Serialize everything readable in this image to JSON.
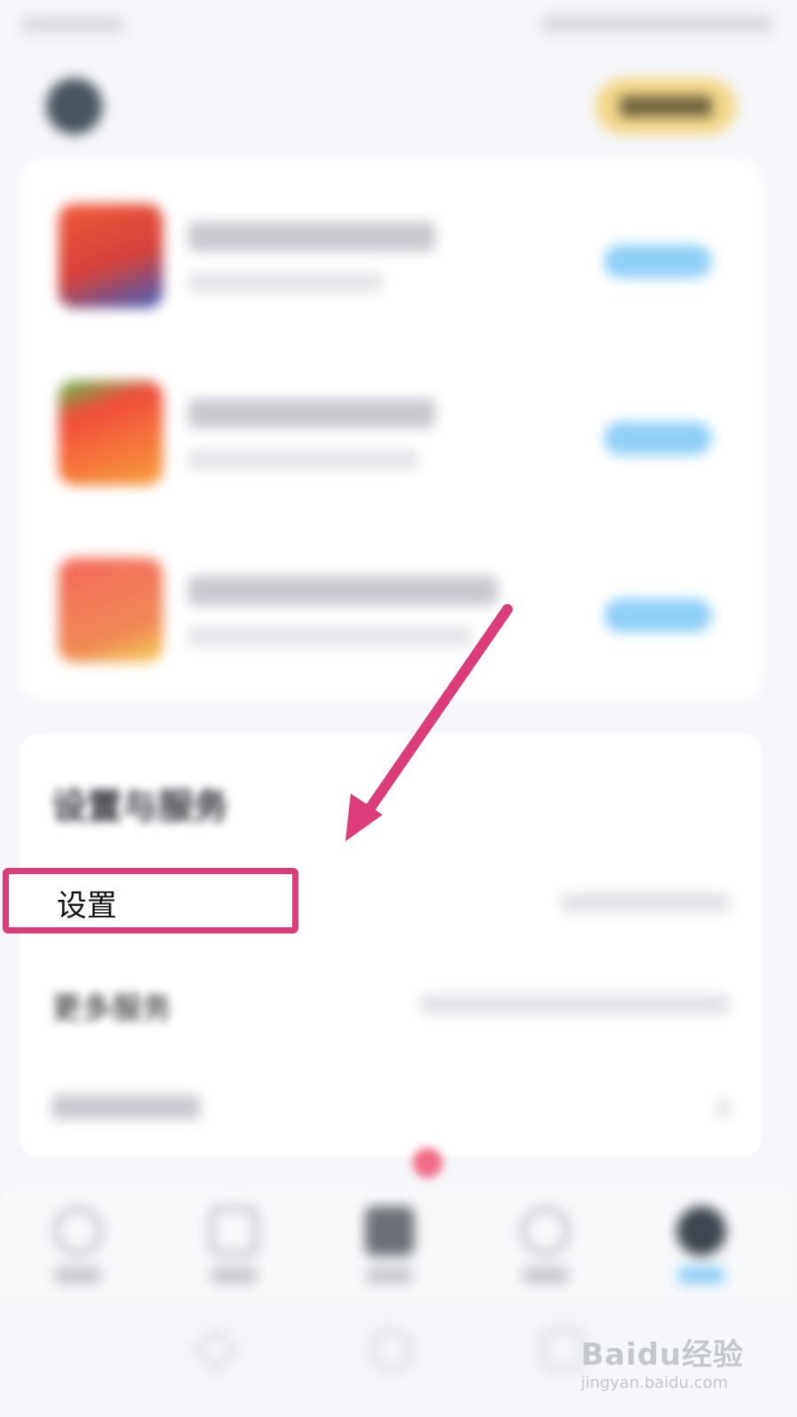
{
  "colors": {
    "accent": "#dc3c79",
    "vip_gold": "#f2d88a",
    "promo_button": "#8fd0f7",
    "badge_red": "#f06c86"
  },
  "header": {
    "user_name": "",
    "vip_label": ""
  },
  "promos": [
    {
      "title": "",
      "subtitle": "",
      "button": "",
      "thumb_color": "#e8553f"
    },
    {
      "title": "",
      "subtitle": "",
      "button": "",
      "thumb_color": "#f24b3a"
    },
    {
      "title": "",
      "subtitle": "",
      "button": "",
      "thumb_color": "#f07058"
    }
  ],
  "settings_section": {
    "title": "设置与服务",
    "items": [
      {
        "label": "设置"
      },
      {
        "label": "更多服务"
      },
      {
        "label": ""
      }
    ]
  },
  "bottom_nav": {
    "items": [
      {
        "icon": "home-icon"
      },
      {
        "icon": "discover-icon"
      },
      {
        "icon": "message-icon"
      },
      {
        "icon": "cart-icon"
      },
      {
        "icon": "profile-icon"
      }
    ]
  },
  "watermark": {
    "main": "Baidu经验",
    "sub": "jingyan.baidu.com"
  }
}
